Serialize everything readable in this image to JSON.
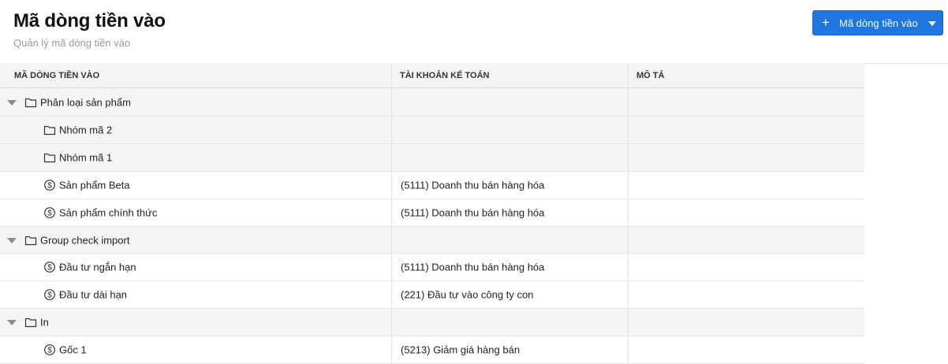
{
  "page": {
    "title": "Mã dòng tiền vào",
    "subtitle": "Quản lý mã dòng tiền vào",
    "add_button_label": "Mã dòng tiền vào"
  },
  "table": {
    "columns": [
      "MÃ DÒNG TIỀN VÀO",
      "TÀI KHOẢN KẾ TOÁN",
      "MÔ TẢ"
    ],
    "rows": [
      {
        "name": "Phân loại sản phẩm",
        "account": "",
        "description": "",
        "type": "folder",
        "expandable": true
      },
      {
        "name": "Nhóm mã 2",
        "account": "",
        "description": "",
        "type": "folder",
        "expandable": false
      },
      {
        "name": "Nhóm mã 1",
        "account": "",
        "description": "",
        "type": "folder",
        "expandable": false
      },
      {
        "name": "Sản phẩm Beta",
        "account": "(5111) Doanh thu bán hàng hóa",
        "description": "",
        "type": "item"
      },
      {
        "name": "Sản phẩm chính thức",
        "account": "(5111) Doanh thu bán hàng hóa",
        "description": "",
        "type": "item"
      },
      {
        "name": "Group check import",
        "account": "",
        "description": "",
        "type": "folder",
        "expandable": true
      },
      {
        "name": "Đầu tư ngắn hạn",
        "account": "(5111) Doanh thu bán hàng hóa",
        "description": "",
        "type": "item"
      },
      {
        "name": "Đầu tư dài hạn",
        "account": "(221) Đầu tư vào công ty con",
        "description": "",
        "type": "item"
      },
      {
        "name": "In",
        "account": "",
        "description": "",
        "type": "folder",
        "expandable": true
      },
      {
        "name": "Gốc 1",
        "account": "(5213) Giảm giá hàng bán",
        "description": "",
        "type": "item"
      }
    ]
  },
  "icons": {
    "add": "plus-icon",
    "dropdown": "caret-down-icon",
    "group": "folder-icon",
    "item": "dollar-circle-icon",
    "expand": "expand-triangle-icon"
  },
  "colors": {
    "primary": "#1f76e0",
    "group_row_bg": "#f4f4f4",
    "header_bg": "#f4f4f4",
    "subtitle": "#9a9a9a"
  }
}
